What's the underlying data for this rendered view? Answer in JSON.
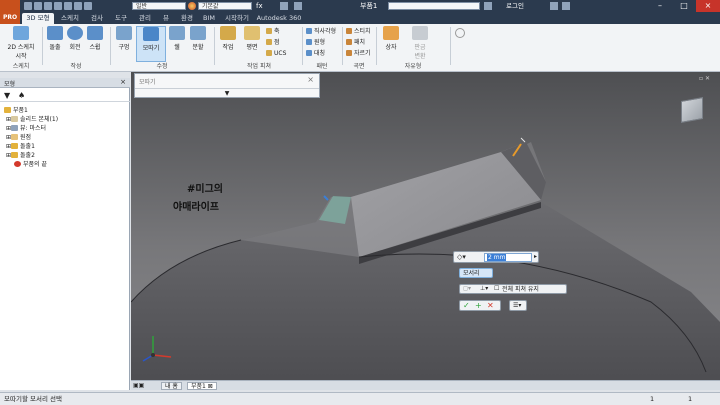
{
  "titlebar": {
    "logo": "PRO",
    "material": "일반",
    "appearance": "기본값",
    "doc_title": "부품1",
    "user": "로그인",
    "fx": "fx"
  },
  "tabs": [
    "3D 모형",
    "스케치",
    "검사",
    "도구",
    "관리",
    "뷰",
    "환경",
    "BIM",
    "시작하기",
    "Autodesk 360"
  ],
  "ribbon": {
    "sketch": {
      "label": "2D 스케치\n시작",
      "group": "스케치"
    },
    "create": {
      "buttons": [
        "돌출",
        "회전",
        "스윕"
      ],
      "group": "작성"
    },
    "modify": {
      "buttons": [
        "구멍",
        "모따기",
        "쉘",
        "분할"
      ],
      "group": "수정"
    },
    "work": {
      "buttons": [
        "작업",
        "평면"
      ],
      "smalls": [
        "축",
        "점",
        "UCS"
      ],
      "group": "작업 피쳐"
    },
    "pattern": {
      "smalls": [
        "직사각형",
        "원형",
        "대칭"
      ],
      "group": "패턴"
    },
    "surface": {
      "smalls": [
        "스티치",
        "패치",
        "자르기"
      ],
      "group": "곡면"
    },
    "freeform": {
      "buttons": [
        "상자"
      ],
      "group": "자유형"
    },
    "convert": {
      "label": "판금\n변환"
    }
  },
  "browser": {
    "title": "모형",
    "tree": [
      {
        "label": "부품1",
        "indent": 0
      },
      {
        "label": "솔리드 본체(1)",
        "indent": 1
      },
      {
        "label": "뷰: 마스터",
        "indent": 1
      },
      {
        "label": "원점",
        "indent": 1
      },
      {
        "label": "돌출1",
        "indent": 1
      },
      {
        "label": "돌출2",
        "indent": 1
      },
      {
        "label": "부품의 끝",
        "indent": 1
      }
    ]
  },
  "fillet_dialog": {
    "title": "모따기"
  },
  "annotation": {
    "line1": "#미그의",
    "line2": "야매라이프"
  },
  "minitool": {
    "distance_value": "2 mm",
    "edges_label": "모서리",
    "all_edges_label": "전체 피쳐 유지"
  },
  "doc_tabs": [
    "내 홈",
    "부품1"
  ],
  "status": {
    "message": "모따기할 모서리 선택",
    "count1": "1",
    "count2": "1"
  },
  "colors": {
    "accent_blue": "#3c7fd6",
    "titlebar": "#2b3a4e",
    "close_red": "#c7342a",
    "brand_orange": "#c8501c"
  }
}
